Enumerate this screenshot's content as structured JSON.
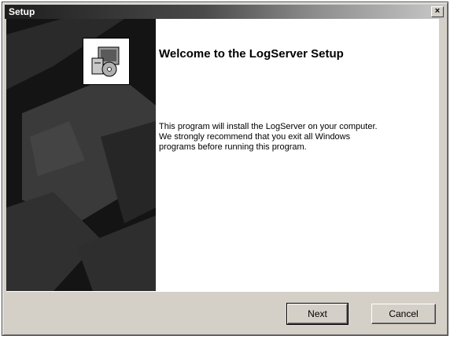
{
  "window": {
    "title": "Setup",
    "close_label": "×"
  },
  "main": {
    "heading": "Welcome to the LogServer Setup",
    "description_lines": [
      "This program will install the LogServer on your computer.",
      "We strongly recommend that you exit all Windows",
      "programs before running this program."
    ]
  },
  "buttons": {
    "next_label": "Next",
    "cancel_label": "Cancel"
  },
  "icons": {
    "setup_icon": "installer-package-icon",
    "close_icon": "close-icon"
  },
  "colors": {
    "side_panel": "#141414",
    "dialog_face": "#d4d0c8",
    "title_start": "#1e1e1e"
  }
}
